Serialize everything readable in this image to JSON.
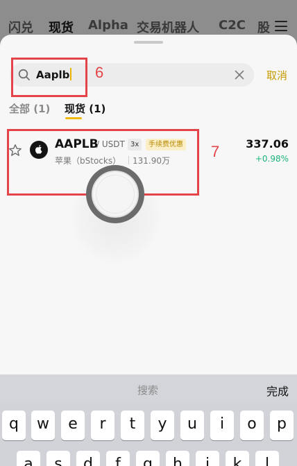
{
  "top_nav": {
    "tabs": [
      {
        "label": "闪兑"
      },
      {
        "label": "现货"
      },
      {
        "label": "Alpha"
      },
      {
        "label": "交易机器人"
      },
      {
        "label": "C2C"
      },
      {
        "label": "股"
      }
    ]
  },
  "search": {
    "value": "Aaplb",
    "cancel_label": "取消"
  },
  "filters": {
    "all_label": "全部 (1)",
    "spot_label": "现货 (1)"
  },
  "result": {
    "symbol": "AAPLB",
    "quote": "/ USDT",
    "leverage": "3x",
    "promo": "手续费优惠",
    "name": "苹果（bStocks）",
    "volume": "131.90万",
    "price": "337.06",
    "change": "+0.98%"
  },
  "annotations": {
    "search_number": "6",
    "result_number": "7"
  },
  "keyboard": {
    "bar_label": "搜索",
    "done_label": "完成",
    "row1": [
      "q",
      "w",
      "e",
      "r",
      "t",
      "y",
      "u",
      "i",
      "o",
      "p"
    ],
    "row2": [
      "a",
      "s",
      "d",
      "f",
      "g",
      "h",
      "j",
      "k",
      "l"
    ]
  },
  "colors": {
    "accent": "#f0b90b",
    "cancel": "#c59a00",
    "positive": "#1db47b",
    "annotation": "#e44448"
  }
}
